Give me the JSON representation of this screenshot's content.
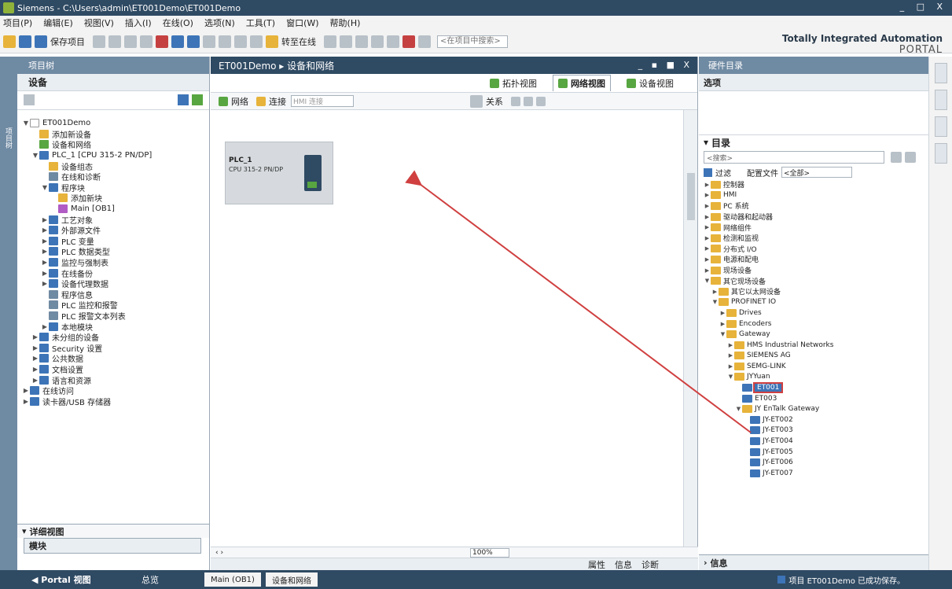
{
  "window": {
    "title": "Siemens - C:\\Users\\admin\\ET001Demo\\ET001Demo",
    "buttons": "_ □ X"
  },
  "menu": [
    "项目(P)",
    "编辑(E)",
    "视图(V)",
    "插入(I)",
    "在线(O)",
    "选项(N)",
    "工具(T)",
    "窗口(W)",
    "帮助(H)"
  ],
  "toolbar": {
    "save_label": "保存项目",
    "go_online": "转至在线",
    "search_placeholder": "<在项目中搜索>"
  },
  "brand": {
    "line1": "Totally Integrated Automation",
    "line2": "PORTAL"
  },
  "left_vertical_tab": "项目树",
  "project_tree": {
    "header": "项目树",
    "section": "设备",
    "items": [
      {
        "label": "ET001Demo",
        "level": 0,
        "arrow": "▼",
        "color": "#ffffff"
      },
      {
        "label": "添加新设备",
        "level": 1,
        "arrow": "",
        "color": "#e7b33a"
      },
      {
        "label": "设备和网络",
        "level": 1,
        "arrow": "",
        "color": "#58a641"
      },
      {
        "label": "PLC_1 [CPU 315-2 PN/DP]",
        "level": 1,
        "arrow": "▼",
        "color": "#3d74b7"
      },
      {
        "label": "设备组态",
        "level": 2,
        "arrow": "",
        "color": "#e7b33a"
      },
      {
        "label": "在线和诊断",
        "level": 2,
        "arrow": "",
        "color": "#6f8aa3"
      },
      {
        "label": "程序块",
        "level": 2,
        "arrow": "▼",
        "color": "#3d74b7"
      },
      {
        "label": "添加新块",
        "level": 3,
        "arrow": "",
        "color": "#e7b33a"
      },
      {
        "label": "Main [OB1]",
        "level": 3,
        "arrow": "",
        "color": "#b05cc4"
      },
      {
        "label": "工艺对象",
        "level": 2,
        "arrow": "▶",
        "color": "#3d74b7"
      },
      {
        "label": "外部源文件",
        "level": 2,
        "arrow": "▶",
        "color": "#3d74b7"
      },
      {
        "label": "PLC 变量",
        "level": 2,
        "arrow": "▶",
        "color": "#3d74b7"
      },
      {
        "label": "PLC 数据类型",
        "level": 2,
        "arrow": "▶",
        "color": "#3d74b7"
      },
      {
        "label": "监控与强制表",
        "level": 2,
        "arrow": "▶",
        "color": "#3d74b7"
      },
      {
        "label": "在线备份",
        "level": 2,
        "arrow": "▶",
        "color": "#3d74b7"
      },
      {
        "label": "设备代理数据",
        "level": 2,
        "arrow": "▶",
        "color": "#3d74b7"
      },
      {
        "label": "程序信息",
        "level": 2,
        "arrow": "",
        "color": "#6f8aa3"
      },
      {
        "label": "PLC 监控和报警",
        "level": 2,
        "arrow": "",
        "color": "#6f8aa3"
      },
      {
        "label": "PLC 报警文本列表",
        "level": 2,
        "arrow": "",
        "color": "#6f8aa3"
      },
      {
        "label": "本地模块",
        "level": 2,
        "arrow": "▶",
        "color": "#3d74b7"
      },
      {
        "label": "未分组的设备",
        "level": 1,
        "arrow": "▶",
        "color": "#3d74b7"
      },
      {
        "label": "Security 设置",
        "level": 1,
        "arrow": "▶",
        "color": "#3d74b7"
      },
      {
        "label": "公共数据",
        "level": 1,
        "arrow": "▶",
        "color": "#3d74b7"
      },
      {
        "label": "文档设置",
        "level": 1,
        "arrow": "▶",
        "color": "#3d74b7"
      },
      {
        "label": "语言和资源",
        "level": 1,
        "arrow": "▶",
        "color": "#3d74b7"
      },
      {
        "label": "在线访问",
        "level": 0,
        "arrow": "▶",
        "color": "#3d74b7"
      },
      {
        "label": "读卡器/USB 存储器",
        "level": 0,
        "arrow": "▶",
        "color": "#3d74b7"
      }
    ],
    "detail_header": "详细视图",
    "detail_sub": "模块"
  },
  "editor": {
    "breadcrumb": "ET001Demo ▸ 设备和网络",
    "buttons": "_ ▪ ■ X",
    "view_tabs": [
      {
        "label": "拓扑视图",
        "active": false
      },
      {
        "label": "网络视图",
        "active": true
      },
      {
        "label": "设备视图",
        "active": false
      }
    ],
    "net_toolbar": {
      "network": "网络",
      "connect": "连接",
      "connect_type": "HMI 连接",
      "relation": "关系"
    },
    "device": {
      "name": "PLC_1",
      "cpu": "CPU 315-2 PN/DP"
    },
    "zoom": "100%",
    "bottom_tabs": [
      "属性",
      "信息",
      "诊断"
    ]
  },
  "catalog": {
    "header": "硬件目录",
    "options": "选项",
    "section": "目录",
    "search": "<搜索>",
    "filter": "过滤",
    "profile_label": "配置文件",
    "profile_value": "<全部>",
    "items": [
      {
        "label": "控制器",
        "level": 0,
        "arrow": "▶"
      },
      {
        "label": "HMI",
        "level": 0,
        "arrow": "▶"
      },
      {
        "label": "PC 系统",
        "level": 0,
        "arrow": "▶"
      },
      {
        "label": "驱动器和起动器",
        "level": 0,
        "arrow": "▶"
      },
      {
        "label": "网络组件",
        "level": 0,
        "arrow": "▶"
      },
      {
        "label": "检测和监视",
        "level": 0,
        "arrow": "▶"
      },
      {
        "label": "分布式 I/O",
        "level": 0,
        "arrow": "▶"
      },
      {
        "label": "电源和配电",
        "level": 0,
        "arrow": "▶"
      },
      {
        "label": "现场设备",
        "level": 0,
        "arrow": "▶"
      },
      {
        "label": "其它现场设备",
        "level": 0,
        "arrow": "▼"
      },
      {
        "label": "其它以太网设备",
        "level": 1,
        "arrow": "▶"
      },
      {
        "label": "PROFINET IO",
        "level": 1,
        "arrow": "▼"
      },
      {
        "label": "Drives",
        "level": 2,
        "arrow": "▶"
      },
      {
        "label": "Encoders",
        "level": 2,
        "arrow": "▶"
      },
      {
        "label": "Gateway",
        "level": 2,
        "arrow": "▼"
      },
      {
        "label": "HMS Industrial Networks",
        "level": 3,
        "arrow": "▶"
      },
      {
        "label": "SIEMENS AG",
        "level": 3,
        "arrow": "▶"
      },
      {
        "label": "SEMG-LINK",
        "level": 3,
        "arrow": "▶"
      },
      {
        "label": "JYYuan",
        "level": 3,
        "arrow": "▼"
      },
      {
        "label": "ET001",
        "level": 4,
        "arrow": "",
        "highlight": true
      },
      {
        "label": "ET003",
        "level": 4,
        "arrow": ""
      },
      {
        "label": "JY EnTalk Gateway",
        "level": 4,
        "arrow": "▼"
      },
      {
        "label": "JY-ET002",
        "level": 5,
        "arrow": ""
      },
      {
        "label": "JY-ET003",
        "level": 5,
        "arrow": ""
      },
      {
        "label": "JY-ET004",
        "level": 5,
        "arrow": ""
      },
      {
        "label": "JY-ET005",
        "level": 5,
        "arrow": ""
      },
      {
        "label": "JY-ET006",
        "level": 5,
        "arrow": ""
      },
      {
        "label": "JY-ET007",
        "level": 5,
        "arrow": ""
      }
    ],
    "info": "信息"
  },
  "statusbar": {
    "portal": "◀ Portal 视图",
    "overview": "总览",
    "tasks": [
      "Main (OB1)",
      "设备和网络"
    ],
    "message": "项目 ET001Demo 已成功保存。"
  }
}
